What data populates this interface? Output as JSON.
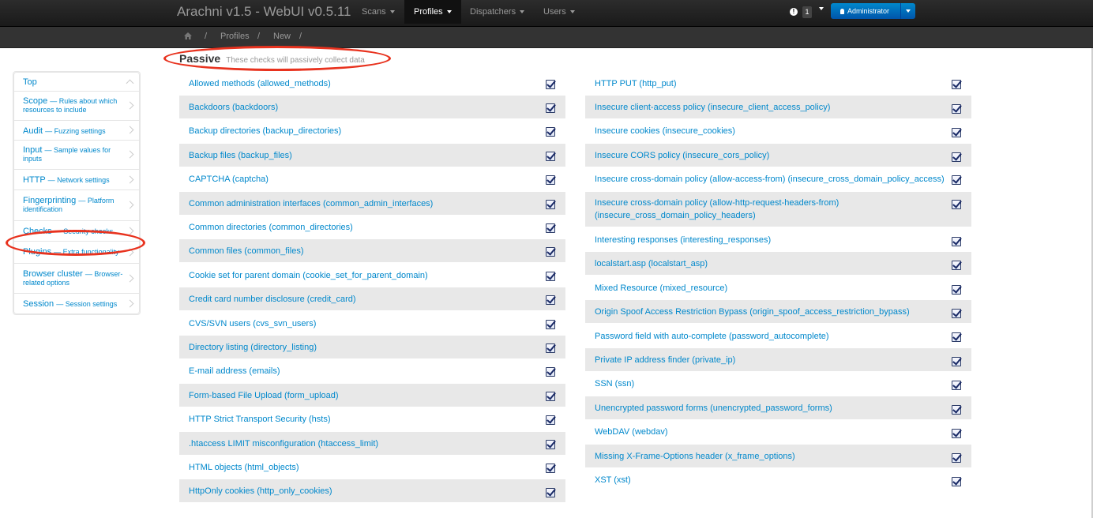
{
  "brand": "Arachni v1.5 - WebUI v0.5.11",
  "nav": [
    {
      "label": "Scans"
    },
    {
      "label": "Profiles"
    },
    {
      "label": "Dispatchers"
    },
    {
      "label": "Users"
    }
  ],
  "notifications": {
    "count": "1",
    "icon": "exclamation-icon"
  },
  "user": {
    "label": "Administrator",
    "icon": "user-icon"
  },
  "breadcrumb": {
    "home_icon": "home-icon",
    "sep": "/",
    "items": [
      "Profiles",
      "New"
    ]
  },
  "sidebar": {
    "items": [
      {
        "title": "Top",
        "sub": ""
      },
      {
        "title": "Scope",
        "sub": "— Rules about which resources to include"
      },
      {
        "title": "Audit",
        "sub": "— Fuzzing settings"
      },
      {
        "title": "Input",
        "sub": "— Sample values for inputs"
      },
      {
        "title": "HTTP",
        "sub": "— Network settings"
      },
      {
        "title": "Fingerprinting",
        "sub": "— Platform identification"
      },
      {
        "title": "Checks",
        "sub": "— Security checks"
      },
      {
        "title": "Plugins",
        "sub": "— Extra functionality"
      },
      {
        "title": "Browser cluster",
        "sub": "— Browser-related options"
      },
      {
        "title": "Session",
        "sub": "— Session settings"
      }
    ]
  },
  "section": {
    "title": "Passive",
    "subtitle": "These checks will passively collect data"
  },
  "checks_left": [
    {
      "label": "Allowed methods (allowed_methods)",
      "checked": true
    },
    {
      "label": "Backdoors (backdoors)",
      "checked": true
    },
    {
      "label": "Backup directories (backup_directories)",
      "checked": true
    },
    {
      "label": "Backup files (backup_files)",
      "checked": true
    },
    {
      "label": "CAPTCHA (captcha)",
      "checked": true
    },
    {
      "label": "Common administration interfaces (common_admin_interfaces)",
      "checked": true
    },
    {
      "label": "Common directories (common_directories)",
      "checked": true
    },
    {
      "label": "Common files (common_files)",
      "checked": true
    },
    {
      "label": "Cookie set for parent domain (cookie_set_for_parent_domain)",
      "checked": true
    },
    {
      "label": "Credit card number disclosure (credit_card)",
      "checked": true
    },
    {
      "label": "CVS/SVN users (cvs_svn_users)",
      "checked": true
    },
    {
      "label": "Directory listing (directory_listing)",
      "checked": true
    },
    {
      "label": "E-mail address (emails)",
      "checked": true
    },
    {
      "label": "Form-based File Upload (form_upload)",
      "checked": true
    },
    {
      "label": "HTTP Strict Transport Security (hsts)",
      "checked": true
    },
    {
      "label": ".htaccess LIMIT misconfiguration (htaccess_limit)",
      "checked": true
    },
    {
      "label": "HTML objects (html_objects)",
      "checked": true
    },
    {
      "label": "HttpOnly cookies (http_only_cookies)",
      "checked": true
    }
  ],
  "checks_right": [
    {
      "label": "HTTP PUT (http_put)",
      "checked": true
    },
    {
      "label": "Insecure client-access policy (insecure_client_access_policy)",
      "checked": true
    },
    {
      "label": "Insecure cookies (insecure_cookies)",
      "checked": true
    },
    {
      "label": "Insecure CORS policy (insecure_cors_policy)",
      "checked": true
    },
    {
      "label": "Insecure cross-domain policy (allow-access-from) (insecure_cross_domain_policy_access)",
      "checked": true
    },
    {
      "label": "Insecure cross-domain policy (allow-http-request-headers-from) (insecure_cross_domain_policy_headers)",
      "checked": true
    },
    {
      "label": "Interesting responses (interesting_responses)",
      "checked": true
    },
    {
      "label": "localstart.asp (localstart_asp)",
      "checked": true
    },
    {
      "label": "Mixed Resource (mixed_resource)",
      "checked": true
    },
    {
      "label": "Origin Spoof Access Restriction Bypass (origin_spoof_access_restriction_bypass)",
      "checked": true
    },
    {
      "label": "Password field with auto-complete (password_autocomplete)",
      "checked": true
    },
    {
      "label": "Private IP address finder (private_ip)",
      "checked": true
    },
    {
      "label": "SSN (ssn)",
      "checked": true
    },
    {
      "label": "Unencrypted password forms (unencrypted_password_forms)",
      "checked": true
    },
    {
      "label": "WebDAV (webdav)",
      "checked": true
    },
    {
      "label": "Missing X-Frame-Options header (x_frame_options)",
      "checked": true
    },
    {
      "label": "XST (xst)",
      "checked": true
    }
  ],
  "colors": {
    "link": "#0088cc",
    "annotation": "#e8321e",
    "row_shade": "#e8e8e8"
  }
}
